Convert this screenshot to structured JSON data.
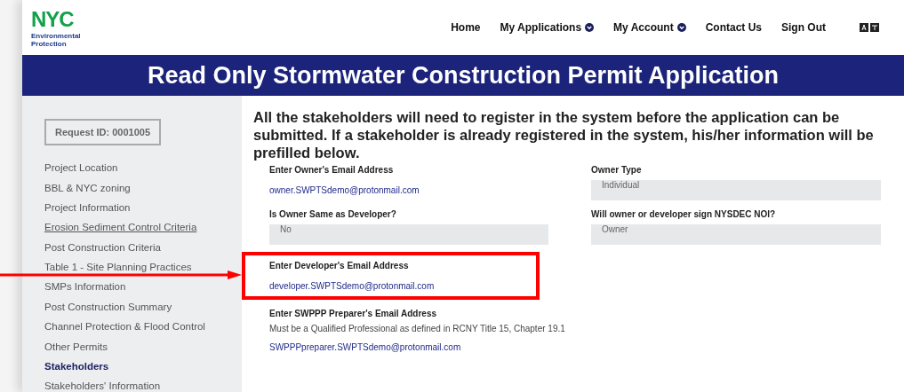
{
  "header": {
    "logo": {
      "title": "NYC",
      "subtitle": "Environmental Protection"
    },
    "nav": [
      {
        "label": "Home",
        "dropdown": false
      },
      {
        "label": "My Applications",
        "dropdown": true
      },
      {
        "label": "My Account",
        "dropdown": true
      },
      {
        "label": "Contact Us",
        "dropdown": false
      },
      {
        "label": "Sign Out",
        "dropdown": false
      }
    ]
  },
  "banner": {
    "title": "Read Only Stormwater Construction Permit Application"
  },
  "sidebar": {
    "request_id": "Request ID: 0001005",
    "items": [
      {
        "label": "Project Location",
        "selected": false
      },
      {
        "label": "BBL & NYC zoning",
        "selected": false
      },
      {
        "label": "Project Information",
        "selected": false
      },
      {
        "label": "Erosion Sediment Control Criteria",
        "selected": false,
        "hovered": true
      },
      {
        "label": "Post Construction Criteria",
        "selected": false
      },
      {
        "label": "Table 1 - Site Planning Practices",
        "selected": false
      },
      {
        "label": "SMPs Information",
        "selected": false
      },
      {
        "label": "Post Construction Summary",
        "selected": false
      },
      {
        "label": "Channel Protection & Flood Control",
        "selected": false
      },
      {
        "label": "Other Permits",
        "selected": false
      },
      {
        "label": "Stakeholders",
        "selected": true
      },
      {
        "label": "Stakeholders' Information",
        "selected": false
      }
    ]
  },
  "main": {
    "intro": "All the stakeholders will need to register in the system before the application can be submitted. If a stakeholder is already registered in the system, his/her information will be prefilled below.",
    "fields": [
      {
        "label": "Enter Owner's Email Address",
        "kind": "link",
        "value": "owner.SWPTSdemo@protonmail.com"
      },
      {
        "label": "Owner Type",
        "kind": "readonly",
        "value": "Individual"
      },
      {
        "label": "Is Owner Same as Developer?",
        "kind": "readonly",
        "value": "No"
      },
      {
        "label": "Will owner or developer sign NYSDEC NOI?",
        "kind": "readonly",
        "value": "Owner"
      },
      {
        "label": "Enter Developer's Email Address",
        "kind": "link",
        "value": "developer.SWPTSdemo@protonmail.com",
        "highlighted": true
      },
      {
        "label": "Enter SWPPP Preparer's Email Address",
        "kind": "link",
        "note": "Must be a Qualified Professional as defined in RCNY Title 15, Chapter 19.1",
        "value": "SWPPPpreparer.SWPTSdemo@protonmail.com"
      }
    ]
  }
}
